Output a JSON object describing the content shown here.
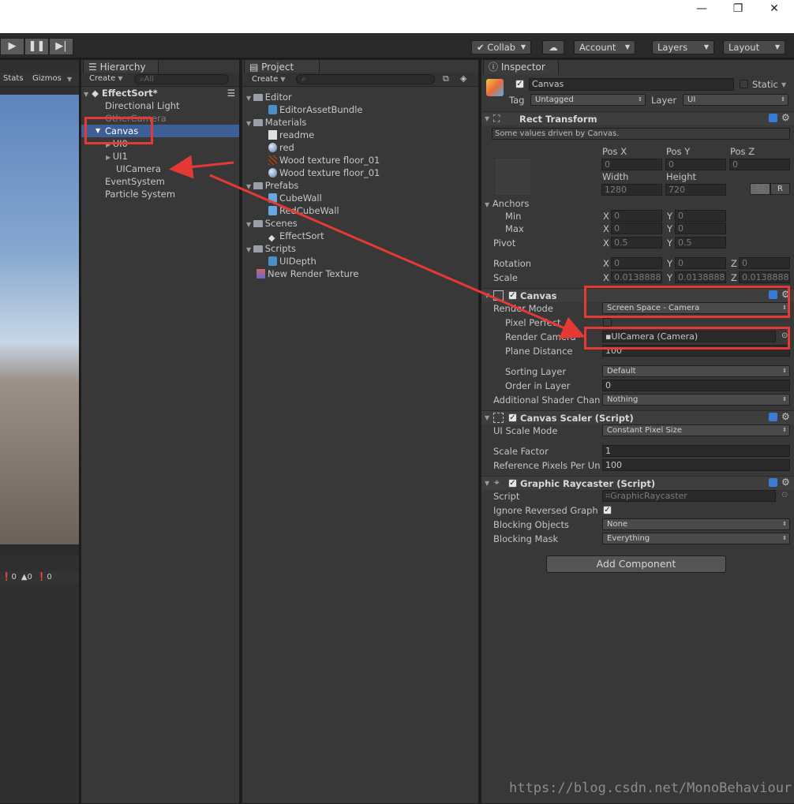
{
  "window": {
    "controls": [
      "minimize-icon",
      "restore-icon",
      "close-icon"
    ]
  },
  "toolbar": {
    "collab_label": "Collab",
    "account_label": "Account",
    "layers_label": "Layers",
    "layout_label": "Layout"
  },
  "scene": {
    "stats_label": "Stats",
    "gizmos_label": "Gizmos",
    "console_counts": [
      "0",
      "0",
      "0"
    ]
  },
  "hierarchy": {
    "tab_label": "Hierarchy",
    "create_label": "Create",
    "search_placeholder": "All",
    "scene_name": "EffectSort*",
    "items": [
      {
        "label": "Directional Light"
      },
      {
        "label": "OtherCamera"
      },
      {
        "label": "Canvas"
      },
      {
        "label": "UI0"
      },
      {
        "label": "UI1"
      },
      {
        "label": "UICamera"
      },
      {
        "label": "EventSystem"
      },
      {
        "label": "Particle System"
      }
    ]
  },
  "project": {
    "tab_label": "Project",
    "create_label": "Create",
    "items": [
      {
        "label": "Editor"
      },
      {
        "label": "EditorAssetBundle"
      },
      {
        "label": "Materials"
      },
      {
        "label": "readme"
      },
      {
        "label": "red"
      },
      {
        "label": "Wood texture floor_01"
      },
      {
        "label": "Wood texture floor_01"
      },
      {
        "label": "Prefabs"
      },
      {
        "label": "CubeWall"
      },
      {
        "label": "RedCubeWall"
      },
      {
        "label": "Scenes"
      },
      {
        "label": "EffectSort"
      },
      {
        "label": "Scripts"
      },
      {
        "label": "UIDepth"
      },
      {
        "label": "New Render Texture"
      }
    ]
  },
  "inspector": {
    "tab_label": "Inspector",
    "object_name": "Canvas",
    "static_label": "Static",
    "tag_label": "Tag",
    "tag_value": "Untagged",
    "layer_label": "Layer",
    "layer_value": "UI",
    "rect_transform": {
      "title": "Rect Transform",
      "note": "Some values driven by Canvas.",
      "pos_x_label": "Pos X",
      "pos_y_label": "Pos Y",
      "pos_z_label": "Pos Z",
      "pos_x": "0",
      "pos_y": "0",
      "pos_z": "0",
      "width_label": "Width",
      "height_label": "Height",
      "width": "1280",
      "height": "720",
      "r_label": "R",
      "anchors_label": "Anchors",
      "min_label": "Min",
      "max_label": "Max",
      "min_x": "0",
      "min_y": "0",
      "max_x": "0",
      "max_y": "0",
      "pivot_label": "Pivot",
      "pivot_x": "0.5",
      "pivot_y": "0.5",
      "rotation_label": "Rotation",
      "rot_x": "0",
      "rot_y": "0",
      "rot_z": "0",
      "scale_label": "Scale",
      "scale_x": "0.0138888",
      "scale_y": "0.0138888",
      "scale_z": "0.0138888",
      "x": "X",
      "y": "Y",
      "z": "Z"
    },
    "canvas": {
      "title": "Canvas",
      "render_mode_label": "Render Mode",
      "render_mode_value": "Screen Space - Camera",
      "pixel_perfect_label": "Pixel Perfect",
      "render_camera_label": "Render Camera",
      "render_camera_value": "UICamera (Camera)",
      "plane_distance_label": "Plane Distance",
      "plane_distance_value": "100",
      "sorting_layer_label": "Sorting Layer",
      "sorting_layer_value": "Default",
      "order_in_layer_label": "Order in Layer",
      "order_in_layer_value": "0",
      "shader_channels_label": "Additional Shader Chan",
      "shader_channels_value": "Nothing"
    },
    "canvas_scaler": {
      "title": "Canvas Scaler (Script)",
      "scale_mode_label": "UI Scale Mode",
      "scale_mode_value": "Constant Pixel Size",
      "scale_factor_label": "Scale Factor",
      "scale_factor_value": "1",
      "ref_ppu_label": "Reference Pixels Per Un",
      "ref_ppu_value": "100"
    },
    "graphic_raycaster": {
      "title": "Graphic Raycaster (Script)",
      "script_label": "Script",
      "script_value": "GraphicRaycaster",
      "ignore_reversed_label": "Ignore Reversed Graph",
      "blocking_objects_label": "Blocking Objects",
      "blocking_objects_value": "None",
      "blocking_mask_label": "Blocking Mask",
      "blocking_mask_value": "Everything"
    },
    "add_component_label": "Add Component"
  },
  "watermark": "https://blog.csdn.net/MonoBehaviour",
  "colors": {
    "selection": "#3e5f96",
    "annotation_red": "#e53935",
    "panel_bg": "#383838"
  }
}
